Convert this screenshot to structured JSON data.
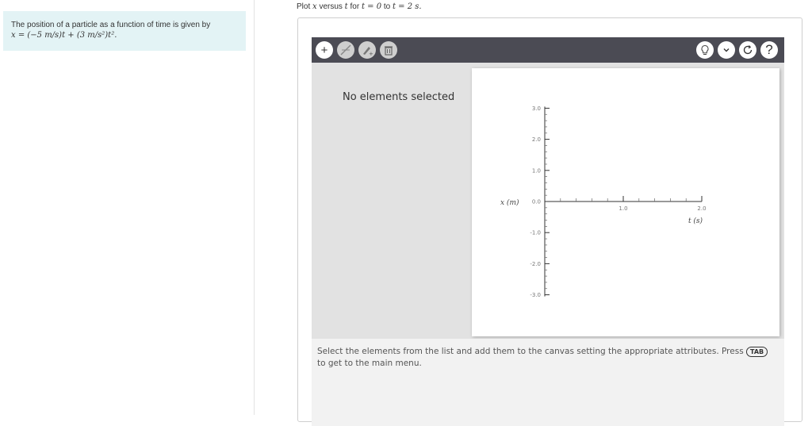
{
  "problem": {
    "text": "The position of a particle as a function of time is given by",
    "equation": "x = (−5 m/s)t + (3 m/s²)t²."
  },
  "instruction": {
    "prefix": "Plot",
    "var_x": "x",
    "versus": "versus",
    "var_t": "t",
    "for": "for",
    "range_start": "t = 0",
    "to": "to",
    "range_end": "t = 2 s."
  },
  "toolbar": {
    "left_buttons": [
      "add-icon",
      "line-tool-icon",
      "point-tool-icon",
      "delete-icon"
    ],
    "right_buttons": [
      "hint-icon",
      "chevron-down-icon",
      "reset-icon",
      "help-icon"
    ],
    "help_label": "?",
    "add_label": "+"
  },
  "panel": {
    "no_selection": "No elements selected"
  },
  "graph": {
    "y_ticks": [
      "3.0",
      "2.0",
      "1.0",
      "0.0",
      "-1.0",
      "-2.0",
      "-3.0"
    ],
    "x_ticks": [
      "1.0",
      "2.0"
    ],
    "y_title": "x (m)",
    "x_title": "t (s)"
  },
  "hint": {
    "before_key": "Select the elements from the list and add them to the canvas setting the appropriate attributes. Press",
    "key": "TAB",
    "after_key": "to get to the main menu."
  }
}
